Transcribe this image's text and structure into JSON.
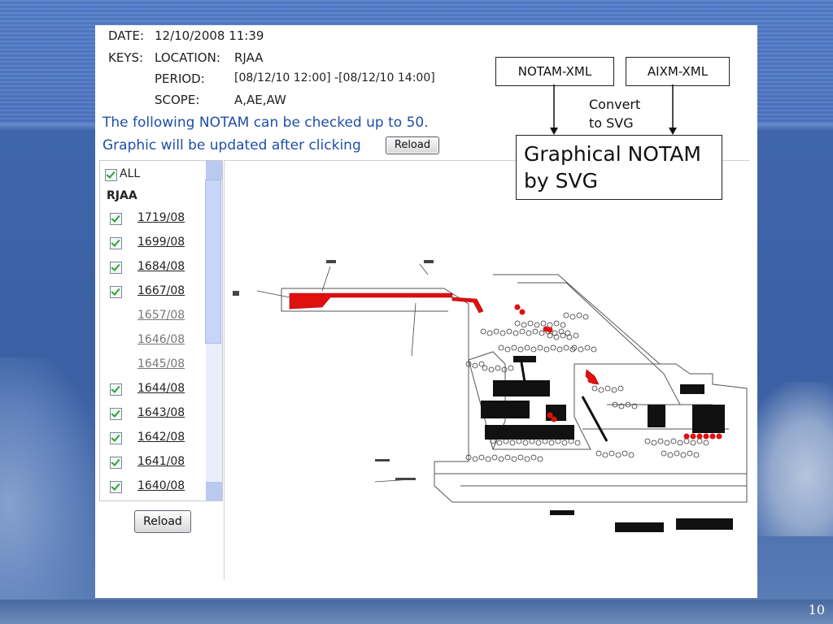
{
  "page_number": "10",
  "header": {
    "date_label": "DATE:",
    "date_value": "12/10/2008 11:39",
    "keys_label": "KEYS:",
    "location_label": "LOCATION:",
    "location_value": "RJAA",
    "period_label": "PERIOD:",
    "period_value": "[08/12/10 12:00] -[08/12/10 14:00]",
    "scope_label": "SCOPE:",
    "scope_value": "A,AE,AW"
  },
  "notice": {
    "line1": "The following NOTAM can be checked up to 50.",
    "line2": "Graphic will be updated after clicking"
  },
  "reload_label": "Reload",
  "sidebar": {
    "all_label": "ALL",
    "all_checked": true,
    "group_label": "RJAA",
    "items": [
      {
        "label": "1719/08",
        "checked": true
      },
      {
        "label": "1699/08",
        "checked": true
      },
      {
        "label": "1684/08",
        "checked": true
      },
      {
        "label": "1667/08",
        "checked": true
      },
      {
        "label": "1657/08",
        "checked": false
      },
      {
        "label": "1646/08",
        "checked": false
      },
      {
        "label": "1645/08",
        "checked": false
      },
      {
        "label": "1644/08",
        "checked": true
      },
      {
        "label": "1643/08",
        "checked": true
      },
      {
        "label": "1642/08",
        "checked": true
      },
      {
        "label": "1641/08",
        "checked": true
      },
      {
        "label": "1640/08",
        "checked": true
      }
    ]
  },
  "callouts": {
    "notam_xml": "NOTAM-XML",
    "aixm_xml": "AIXM-XML",
    "convert_line1": "Convert",
    "convert_line2": "to SVG",
    "graphical_line1": "Graphical NOTAM",
    "graphical_line2": "by  SVG"
  },
  "colors": {
    "notice_blue": "#1f4ea8",
    "highlight_red": "#e01010",
    "check_green": "#29a329"
  }
}
